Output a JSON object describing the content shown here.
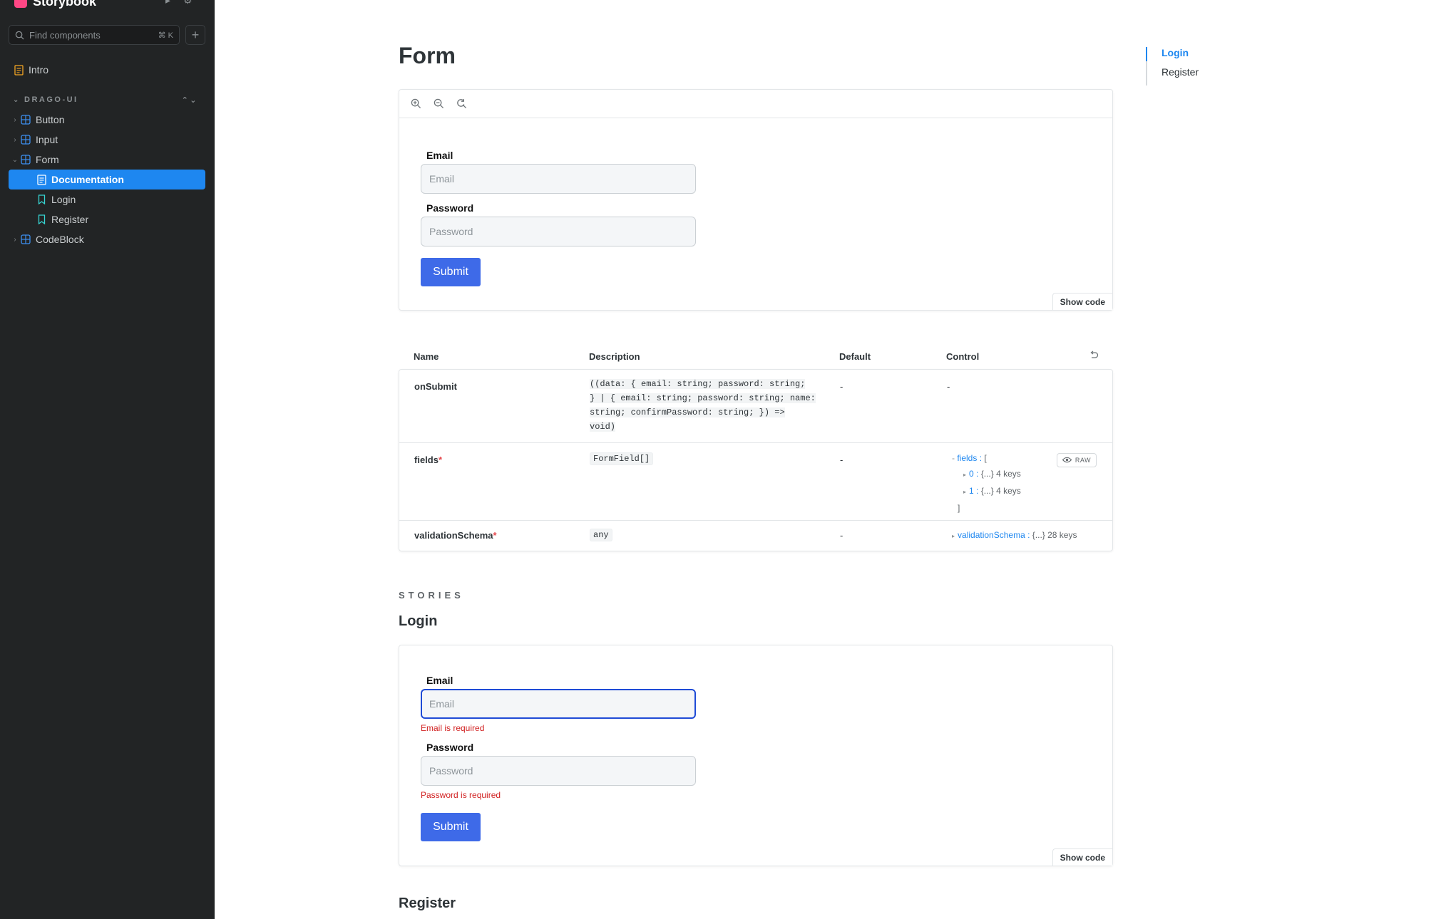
{
  "sidebar": {
    "brand": "Storybook",
    "search": {
      "placeholder": "Find components",
      "shortcut": "⌘ K"
    },
    "items": [
      {
        "label": "Intro",
        "kind": "doc"
      },
      {
        "label": "DRAGO-UI",
        "kind": "group"
      },
      {
        "label": "Button",
        "kind": "component"
      },
      {
        "label": "Input",
        "kind": "component"
      },
      {
        "label": "Form",
        "kind": "component"
      },
      {
        "label": "Documentation",
        "kind": "doc",
        "selected": true
      },
      {
        "label": "Login",
        "kind": "story"
      },
      {
        "label": "Register",
        "kind": "story"
      },
      {
        "label": "CodeBlock",
        "kind": "component"
      }
    ]
  },
  "page": {
    "title": "Form",
    "toc": [
      "Login",
      "Register"
    ]
  },
  "primary": {
    "email_label": "Email",
    "email_placeholder": "Email",
    "password_label": "Password",
    "password_placeholder": "Password",
    "submit": "Submit",
    "show_code": "Show code"
  },
  "args": {
    "headers": {
      "name": "Name",
      "description": "Description",
      "default": "Default",
      "control": "Control"
    },
    "rows": [
      {
        "name": "onSubmit",
        "required": false,
        "description": [
          "((data: { email: string; password: string;",
          "} | { email: string; password: string; name:",
          "string; confirmPassword: string; }) =>",
          "void)"
        ],
        "default": "-",
        "control": "-"
      },
      {
        "name": "fields",
        "required": true,
        "description": "FormField[]",
        "default": "-",
        "control": {
          "key": "fields",
          "open": "[",
          "close": "]",
          "items": [
            {
              "index": "0",
              "summary": "{...} 4 keys"
            },
            {
              "index": "1",
              "summary": "{...} 4 keys"
            }
          ],
          "raw_label": "RAW"
        }
      },
      {
        "name": "validationSchema",
        "required": true,
        "description": "any",
        "default": "-",
        "control": {
          "key": "validationSchema",
          "summary": "{...} 28 keys"
        }
      }
    ],
    "required_mark": "*"
  },
  "stories": {
    "eyebrow": "STORIES",
    "login": {
      "title": "Login",
      "email_label": "Email",
      "email_placeholder": "Email",
      "email_error": "Email is required",
      "password_label": "Password",
      "password_placeholder": "Password",
      "password_error": "Password is required",
      "submit": "Submit",
      "show_code": "Show code"
    },
    "register": {
      "title": "Register"
    }
  },
  "colors": {
    "sidebar_bg": "#222425",
    "selected": "#1e87f0",
    "submit": "#3e6ae8",
    "error": "#d12020"
  }
}
